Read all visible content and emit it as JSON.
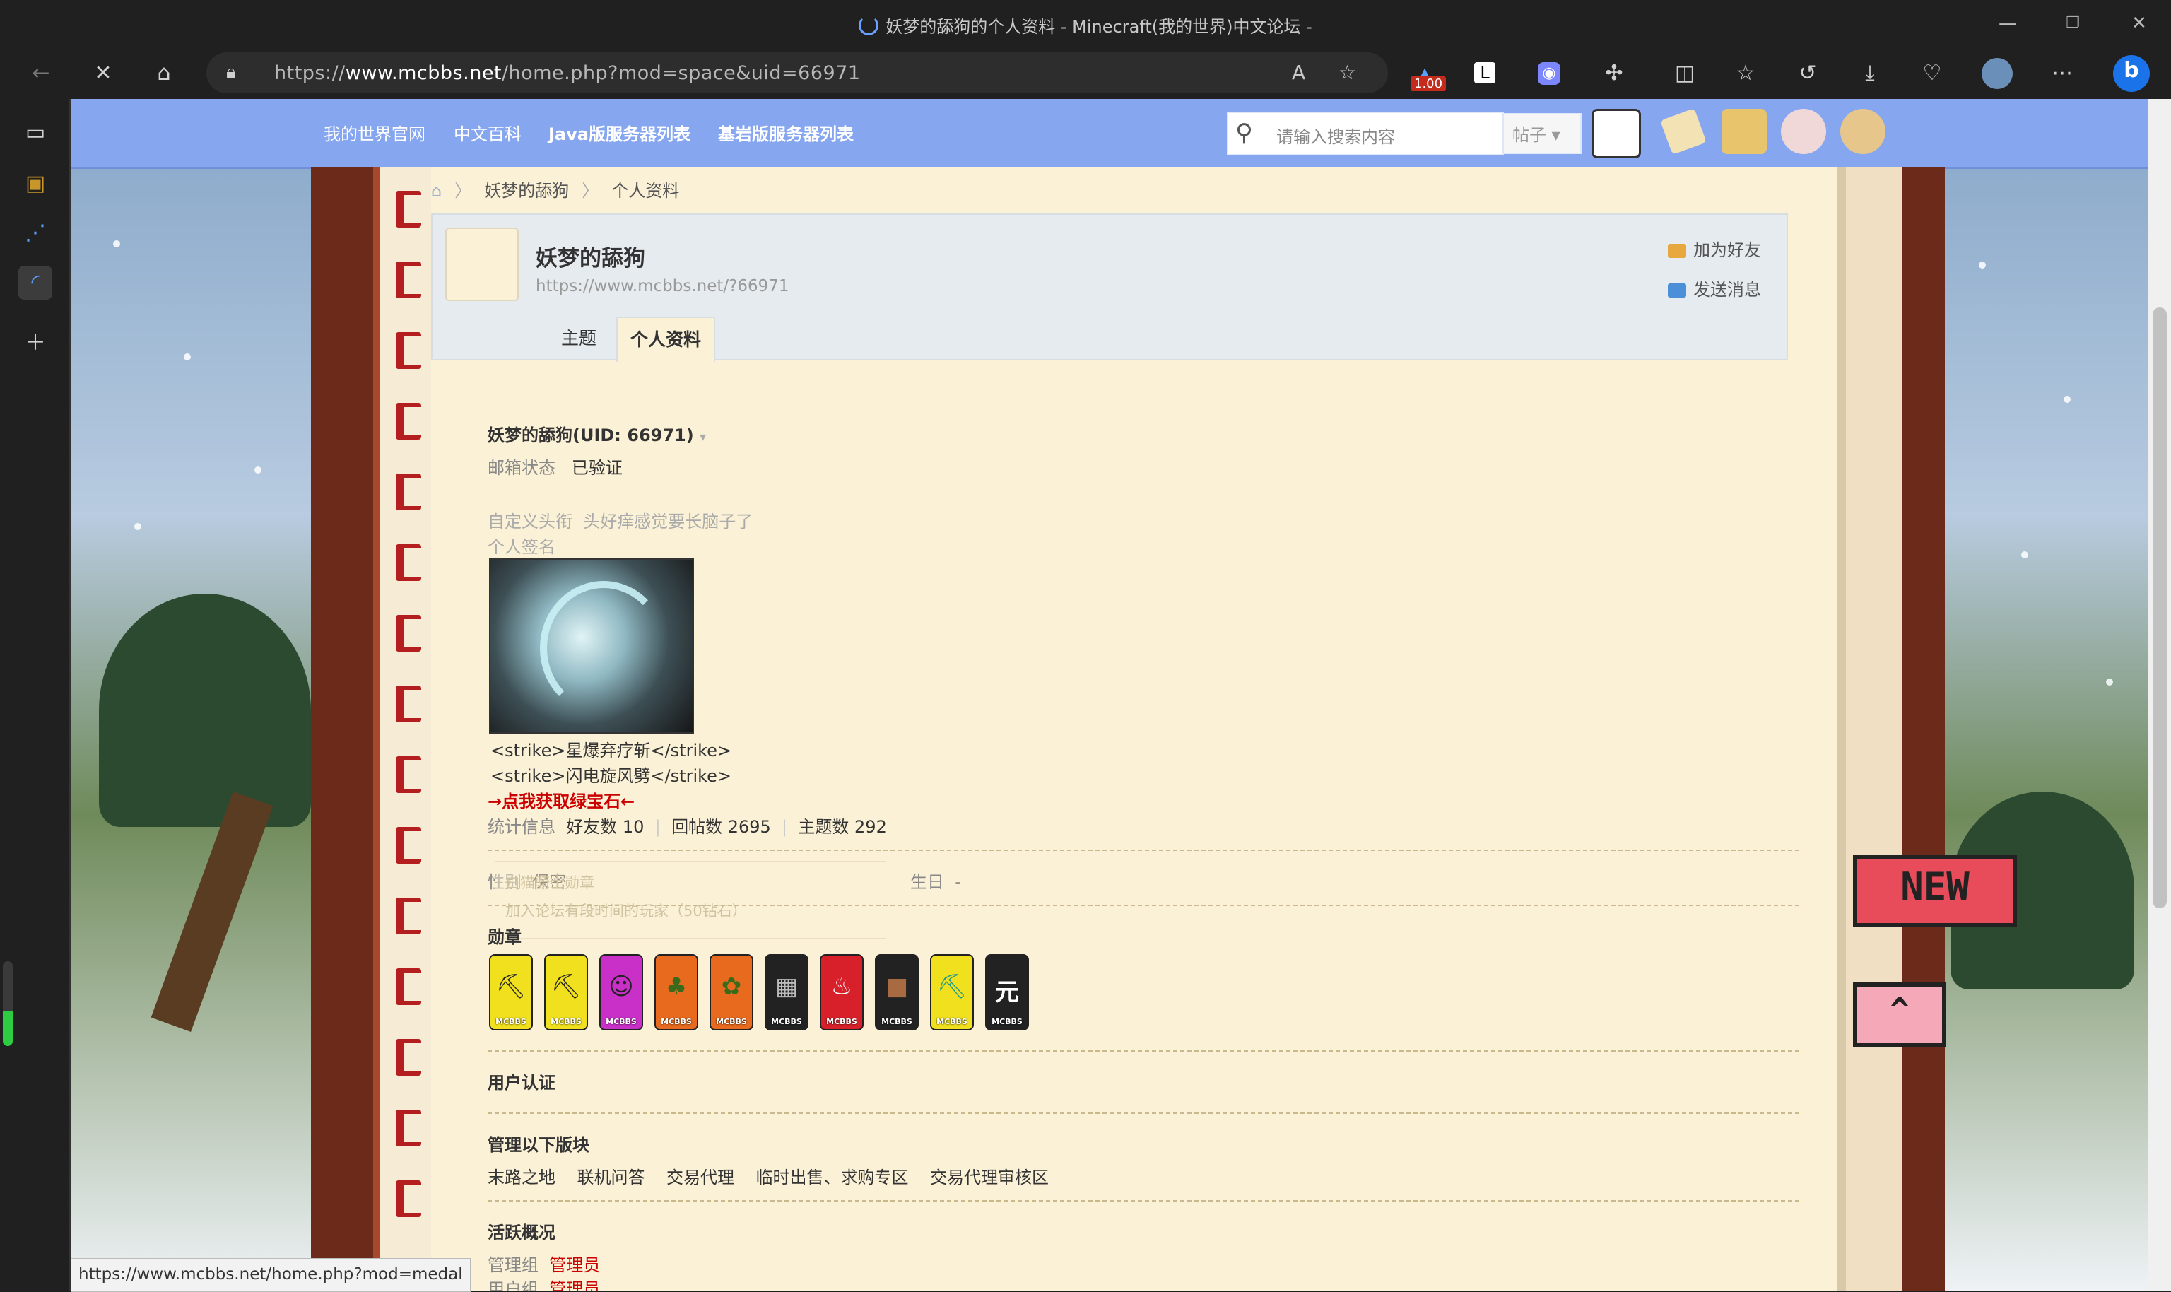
{
  "window": {
    "title": "妖梦的舔狗的个人资料 - Minecraft(我的世界)中文论坛 -"
  },
  "browser": {
    "url_prefix": "https://",
    "url_domain": "www.mcbbs.net",
    "url_path": "/home.php?mod=space&uid=66971",
    "extension_badge": "1.00",
    "status_url": "https://www.mcbbs.net/home.php?mod=medal"
  },
  "nav": {
    "links": [
      "我的世界官网",
      "中文百科",
      "Java版服务器列表",
      "基岩版服务器列表"
    ],
    "search_placeholder": "请输入搜索内容",
    "search_scope": "帖子"
  },
  "breadcrumb": [
    "妖梦的舔狗",
    "个人资料"
  ],
  "header": {
    "username": "妖梦的舔狗",
    "profile_url": "https://www.mcbbs.net/?66971",
    "add_friend": "加为好友",
    "send_message": "发送消息",
    "tabs": [
      "主题",
      "个人资料"
    ]
  },
  "profile": {
    "name_uid": "妖梦的舔狗(UID: 66971)",
    "email_label": "邮箱状态",
    "email_value": "已验证",
    "title_label": "自定义头衔",
    "title_value": "头好痒感觉要长脑子了",
    "signature_label": "个人签名",
    "sig_line1": "<strike>星爆弃疗斩</strike>",
    "sig_line2": "<strike>闪电旋风劈</strike>",
    "sig_link": "→点我获取绿宝石←",
    "stats_label": "统计信息",
    "friends": "好友数 10",
    "replies": "回帖数 2695",
    "threads": "主题数 292",
    "gender_label": "性别",
    "gender_value": "保密",
    "birthday_label": "生日",
    "birthday_value": "-",
    "tooltip_title": "白猫骑士勋章",
    "tooltip_desc": "加入论坛有段时间的玩家（50钻石）",
    "medals_label": "勋章",
    "medal_brand": "MCBBS",
    "auth_label": "用户认证",
    "manage_label": "管理以下版块",
    "boards": [
      "末路之地",
      "联机问答",
      "交易代理",
      "临时出售、求购专区",
      "交易代理审核区"
    ],
    "activity_label": "活跃概况",
    "group_label": "管理组",
    "group_value": "管理员",
    "usergroup_label": "用户组",
    "usergroup_value": "管理员"
  },
  "floating": {
    "new_flag": "NEW"
  },
  "colors": {
    "nav": "#86a6f0",
    "content": "#fbf1d6",
    "link_red": "#cc0000",
    "frame": "#6b2a1a"
  }
}
